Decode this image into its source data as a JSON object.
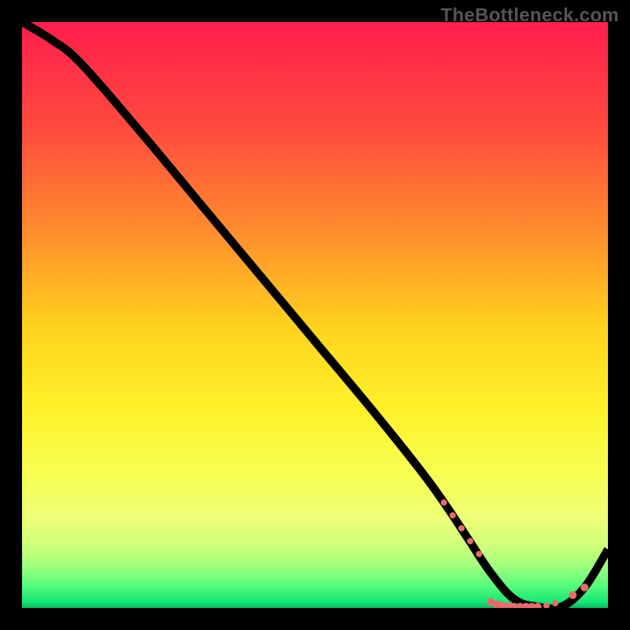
{
  "watermark": "TheBottleneck.com",
  "chart_data": {
    "type": "line",
    "title": "",
    "xlabel": "",
    "ylabel": "",
    "xlim": [
      0,
      100
    ],
    "ylim": [
      0,
      100
    ],
    "gradient_stops": [
      {
        "offset": 0,
        "color": "#ff1e4c"
      },
      {
        "offset": 18,
        "color": "#ff4a3e"
      },
      {
        "offset": 35,
        "color": "#ff8a2e"
      },
      {
        "offset": 52,
        "color": "#ffd21e"
      },
      {
        "offset": 66,
        "color": "#fff12a"
      },
      {
        "offset": 78,
        "color": "#f6ff55"
      },
      {
        "offset": 85,
        "color": "#ecff78"
      },
      {
        "offset": 90,
        "color": "#c8ff7a"
      },
      {
        "offset": 93,
        "color": "#9dff7c"
      },
      {
        "offset": 96,
        "color": "#5bfd7c"
      },
      {
        "offset": 99,
        "color": "#16e676"
      },
      {
        "offset": 100,
        "color": "#07b85e"
      }
    ],
    "series": [
      {
        "name": "bottleneck-curve",
        "x": [
          0,
          5,
          10,
          20,
          30,
          40,
          50,
          60,
          68,
          72,
          76,
          80,
          84,
          88,
          92,
          96,
          100
        ],
        "y": [
          100,
          97,
          93,
          81.5,
          69.5,
          57.5,
          45.5,
          33.5,
          23.5,
          18,
          12,
          6,
          1.5,
          0.2,
          0.2,
          3.5,
          10
        ]
      }
    ],
    "markers": {
      "name": "highlighted-points",
      "color": "#e86b6a",
      "points": [
        {
          "x": 72,
          "y": 18.0,
          "r": 4
        },
        {
          "x": 73.5,
          "y": 15.8,
          "r": 4
        },
        {
          "x": 75,
          "y": 13.6,
          "r": 4
        },
        {
          "x": 76.5,
          "y": 11.4,
          "r": 4
        },
        {
          "x": 78,
          "y": 9.2,
          "r": 4
        },
        {
          "x": 80,
          "y": 1.0,
          "r": 5
        },
        {
          "x": 81,
          "y": 0.6,
          "r": 5
        },
        {
          "x": 82,
          "y": 0.4,
          "r": 5
        },
        {
          "x": 83,
          "y": 0.3,
          "r": 5
        },
        {
          "x": 84,
          "y": 0.2,
          "r": 5
        },
        {
          "x": 85,
          "y": 0.2,
          "r": 5
        },
        {
          "x": 86,
          "y": 0.2,
          "r": 5
        },
        {
          "x": 87,
          "y": 0.2,
          "r": 5
        },
        {
          "x": 88,
          "y": 0.2,
          "r": 5
        },
        {
          "x": 89.5,
          "y": 0.4,
          "r": 4
        },
        {
          "x": 91,
          "y": 0.8,
          "r": 4
        },
        {
          "x": 94,
          "y": 2.2,
          "r": 5
        },
        {
          "x": 96,
          "y": 3.5,
          "r": 5
        }
      ]
    }
  }
}
